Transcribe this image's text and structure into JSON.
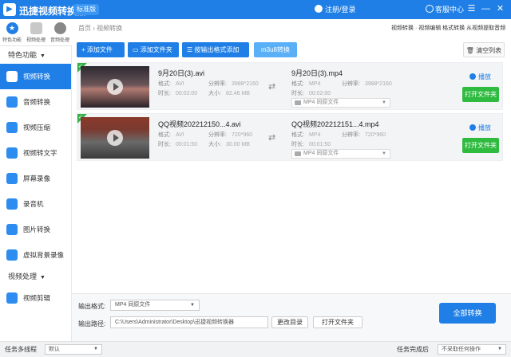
{
  "app": {
    "name": "迅捷视频转换器",
    "edition": "标准版"
  },
  "titlebar": {
    "login": "注册/登录",
    "support": "客服中心",
    "controls": [
      "☰",
      "—",
      "✕"
    ]
  },
  "topnav": [
    {
      "label": "特色功能",
      "icon": "star-icon"
    },
    {
      "label": "视频处理",
      "icon": "film-icon"
    },
    {
      "label": "音频处理",
      "icon": "audio-icon"
    }
  ],
  "sidebar": {
    "section1": "特色功能",
    "items": [
      {
        "label": "视频转换",
        "icon": "video-convert-icon",
        "active": true
      },
      {
        "label": "音频转换",
        "icon": "audio-convert-icon"
      },
      {
        "label": "视频压缩",
        "icon": "video-compress-icon"
      },
      {
        "label": "视频转文字",
        "icon": "video-to-text-icon"
      },
      {
        "label": "屏幕录像",
        "icon": "screen-record-icon"
      },
      {
        "label": "录音机",
        "icon": "recorder-icon"
      },
      {
        "label": "图片转换",
        "icon": "image-convert-icon"
      },
      {
        "label": "虚拟背景录像",
        "icon": "virtual-bg-icon"
      }
    ],
    "section2": "视频处理",
    "items2": [
      {
        "label": "视频剪辑",
        "icon": "video-edit-icon"
      }
    ]
  },
  "breadcrumb": {
    "home": "首页",
    "current": "视频转换"
  },
  "toplinks": "视频转换 · 视频编辑 格式转换 从视频提取音频",
  "toolbar": {
    "add_file": "添加文件",
    "add_folder": "添加文件夹",
    "by_format": "按输出格式添加",
    "m3u8": "m3u8转换",
    "clear": "清空列表"
  },
  "files": [
    {
      "src_name": "9月20日(3).avi",
      "src_format": "AVI",
      "src_resolution": "3988*2160",
      "src_duration": "00:02:00",
      "src_size": "82.46 MB",
      "dst_name": "9月20日(3).mp4",
      "dst_format": "MP4",
      "dst_resolution": "3988*2160",
      "dst_duration": "00:02:00",
      "preset": "MP4  同原文件",
      "play": "播放",
      "open": "打开文件夹"
    },
    {
      "src_name": "QQ视频202212150...4.avi",
      "src_format": "AVI",
      "src_resolution": "720*960",
      "src_duration": "00:01:50",
      "src_size": "30.00 MB",
      "dst_name": "QQ视频202212151...4.mp4",
      "dst_format": "MP4",
      "dst_resolution": "720*960",
      "dst_duration": "00:01:50",
      "preset": "MP4  同原文件",
      "play": "播放",
      "open": "打开文件夹"
    }
  ],
  "labels": {
    "format": "格式:",
    "resolution": "分辨率:",
    "duration": "时长:",
    "size": "大小:"
  },
  "output": {
    "format_label": "输出格式:",
    "format_value": "MP4  同原文件",
    "path_label": "输出路径:",
    "path_value": "C:\\Users\\Administrator\\Desktop\\迅捷视频转换器",
    "change_dir": "更改目录",
    "open_folder": "打开文件夹",
    "convert_all": "全部转换"
  },
  "statusbar": {
    "multithread_label": "任务多线程",
    "multithread_value": "默认",
    "after_label": "任务完成后",
    "after_value": "不采取任何操作"
  },
  "colors": {
    "primary": "#1f7fe6",
    "success": "#2fbb3f",
    "check": "#36b24a"
  }
}
